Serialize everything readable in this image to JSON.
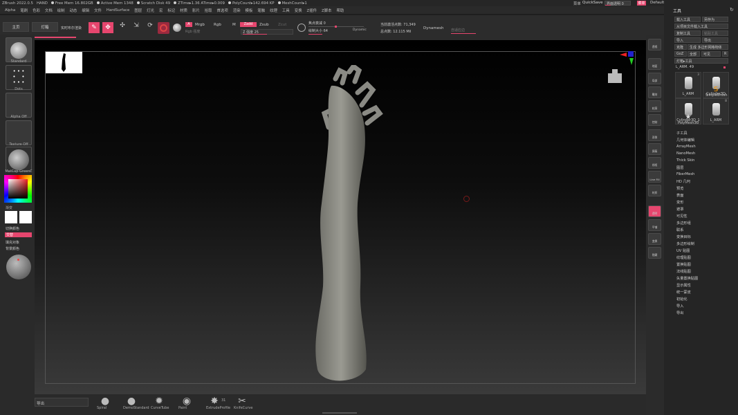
{
  "titlebar": {
    "app": "ZBrush 2022.0.5",
    "doc": "HAND",
    "free_mem": "Free Mem 16.802GB",
    "active_mem": "Active Mem 1348",
    "scratch": "Scratch Disk 49",
    "ztime": "ZTime▸1.36 ATime▸0.009",
    "polycount": "PolyCount▸142.694 KP",
    "meshcount": "MeshCount▸1",
    "menus_label": "菜单",
    "quicksave": "QuickSave",
    "transparency": "界面透明 0",
    "menu_btn": "菜单",
    "script": "DefaultZScript"
  },
  "menubar": [
    "Alpha",
    "笔刷",
    "色彩",
    "文档",
    "绘制",
    "动态",
    "编辑",
    "文件",
    "HardSurface",
    "图层",
    "灯光",
    "宏",
    "标记",
    "材质",
    "影片",
    "拾取",
    "首选项",
    "渲染",
    "模板",
    "笔触",
    "纹理",
    "工具",
    "变换",
    "Z插件",
    "Z脚本",
    "帮助"
  ],
  "toolbar": {
    "home": "主页",
    "lightbox": "灯箱",
    "realtime": "实时布尔渲染",
    "edit": "编辑",
    "draw": "绘制",
    "move": "移动",
    "scale": "缩放",
    "rotate": "旋转",
    "a_btn": "A",
    "mrgb": "Mrgb",
    "rgb": "Rgb",
    "m": "M",
    "zadd": "Zadd",
    "zsub": "Zsub",
    "zcut": "Zcut",
    "rgb_intensity": "Rgb 强度",
    "z_intensity": "Z 强度 25",
    "focal_shift": "焦点衰减 0",
    "draw_size": "绘制大小 64",
    "dynamic": "Dynamic",
    "active_points": "当前激活点数: 71,349",
    "total_points": "总点数: 12.115 Mil",
    "dynamesh": "Dynamesh",
    "adaptive": "自适应边"
  },
  "leftpanel": {
    "brush1": "Standard",
    "brush2": "Dots",
    "brush3": "Alpha Off",
    "brush4": "Texture Off",
    "material": "MatCap GreenC",
    "gradient": "渐变",
    "switch_color": "切换颜色",
    "alternate": "交替",
    "fill_object": "填充对象",
    "bg_color": "背景颜色"
  },
  "rightshelf": [
    "透视",
    "地面",
    "局部",
    "雕刻",
    "轮廓",
    "控制",
    "双侧",
    "屏蔽",
    "线框",
    "Line Fill",
    "材质",
    "透明",
    "平铺",
    "变换",
    "隐藏"
  ],
  "rightpanel": {
    "header": "工具",
    "load": "载入工具",
    "saveas": "另存为",
    "load_from_project": "从项目文件载入工具",
    "copy": "复制工具",
    "paste": "粘贴工具",
    "import": "导入",
    "export": "导出",
    "clone": "克隆",
    "make_polymesh": "生成 多边形网格物体",
    "goz": "GoZ",
    "all": "全部",
    "visible": "可见",
    "r": "R",
    "lightbox_tool": "灯箱▸工具",
    "tool_name": "L_ARM. 49",
    "subtools": [
      {
        "label": "L_ARM",
        "count": "3"
      },
      {
        "label": "Cylinder3D",
        "count": ""
      },
      {
        "label": "SimpleBrush",
        "count": ""
      },
      {
        "label": "Cylinder3D_1",
        "count": ""
      },
      {
        "label": "L_ARM",
        "count": "8"
      },
      {
        "label": "PolyMesh3D",
        "count": ""
      }
    ],
    "menu": [
      "子工具",
      "几何体编辑",
      "ArrayMesh",
      "NanoMesh",
      "Thick Skin",
      "图层",
      "FiberMesh",
      "HD 几何",
      "预览",
      "表面",
      "变形",
      "遮罩",
      "可见性",
      "多边形组",
      "联系",
      "变换目标",
      "多边形绘制",
      "UV 贴图",
      "纹理贴图",
      "置换贴图",
      "法线贴图",
      "矢量置换贴图",
      "显示属性",
      "统一蒙皮",
      "初始化",
      "导入",
      "导出"
    ]
  },
  "bottombar": {
    "export_field": "导出",
    "brushes": [
      {
        "label": "Spiral",
        "glyph": "●"
      },
      {
        "label": "DemoStandard",
        "glyph": "●"
      },
      {
        "label": "CurveTube",
        "glyph": "✹"
      },
      {
        "label": "Paint",
        "glyph": "◉"
      },
      {
        "label": "ExtrudeProfile",
        "glyph": "✸",
        "count": "31"
      },
      {
        "label": "KnifeCurve",
        "glyph": "✂"
      }
    ]
  },
  "colors": {
    "accent": "#e6466e",
    "panel": "#2a2a2a",
    "viewport_top": "#000000",
    "viewport_bottom": "#3a3a3a"
  }
}
